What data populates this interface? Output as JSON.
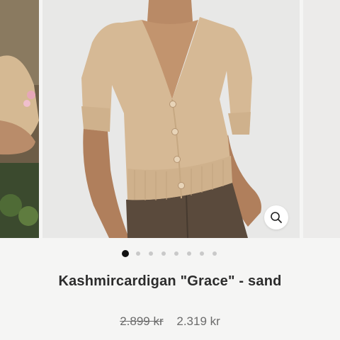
{
  "gallery": {
    "active_index": 0,
    "slide_count": 8,
    "zoom_icon": "magnifier-icon"
  },
  "product": {
    "title": "Kashmircardigan \"Grace\" - sand",
    "price_old": "2.899 kr",
    "price_new": "2.319 kr"
  },
  "colors": {
    "cardigan": "#d6b995",
    "trousers": "#5a4a3c",
    "background": "#f5f5f4",
    "dot_active": "#111111",
    "dot_inactive": "#c9c9c9"
  }
}
